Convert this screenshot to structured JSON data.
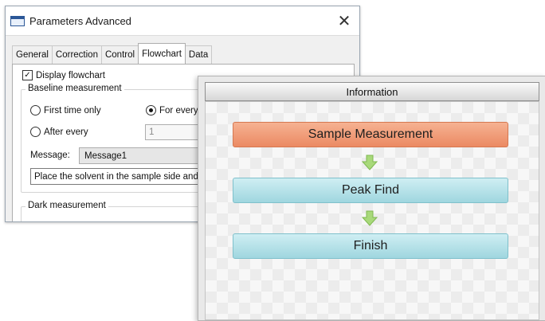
{
  "dialog": {
    "title": "Parameters  Advanced",
    "close_glyph": "✕",
    "tabs": [
      {
        "label": "General",
        "active": false
      },
      {
        "label": "Correction",
        "active": false
      },
      {
        "label": "Control",
        "active": false
      },
      {
        "label": "Flowchart",
        "active": true
      },
      {
        "label": "Data",
        "active": false
      }
    ],
    "display_flowchart": {
      "label": "Display flowchart",
      "checked": true,
      "check_glyph": "✓"
    },
    "baseline": {
      "group_label": "Baseline measurement",
      "first_time_only": "First time only",
      "for_every": "For every",
      "after_every": "After every",
      "after_every_value": "1",
      "message_label": "Message:",
      "message_value": "Message1",
      "message_text": "Place the solvent in the sample side and c"
    },
    "dark": {
      "group_label": "Dark measurement"
    }
  },
  "info_panel": {
    "header": "Information",
    "steps": [
      {
        "label": "Sample Measurement",
        "state": "active"
      },
      {
        "label": "Peak Find",
        "state": "normal"
      },
      {
        "label": "Finish",
        "state": "normal"
      }
    ],
    "colors": {
      "active_step": "#eb8a63",
      "normal_step": "#a9dbe3",
      "arrow": "#9ed46b"
    }
  }
}
